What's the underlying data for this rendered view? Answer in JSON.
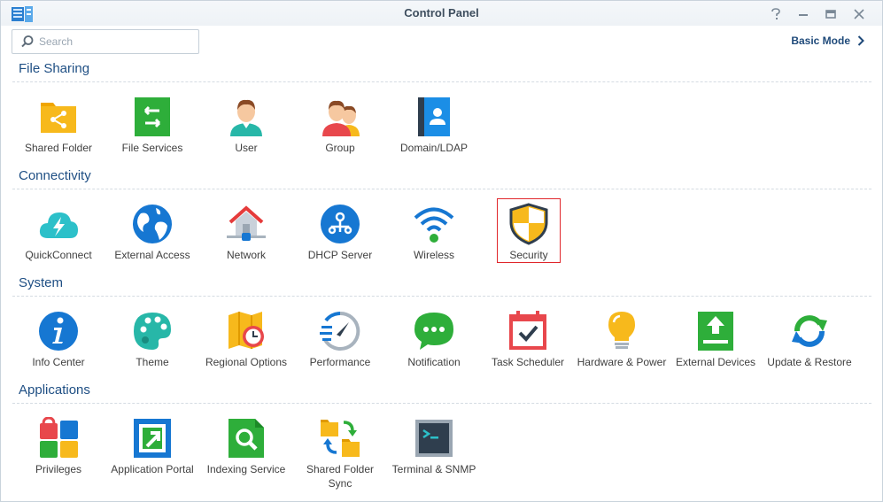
{
  "window": {
    "title": "Control Panel",
    "controls": [
      "help-icon",
      "minimize-icon",
      "maximize-icon",
      "close-icon"
    ]
  },
  "search": {
    "placeholder": "Search",
    "value": ""
  },
  "mode_toggle": {
    "label": "Basic Mode"
  },
  "colors": {
    "accent": "#1f4f84",
    "selection": "#e0262b"
  },
  "sections": [
    {
      "title": "File Sharing",
      "items": [
        {
          "label": "Shared Folder",
          "icon": "shared-folder-icon"
        },
        {
          "label": "File Services",
          "icon": "file-services-icon"
        },
        {
          "label": "User",
          "icon": "user-icon"
        },
        {
          "label": "Group",
          "icon": "group-icon"
        },
        {
          "label": "Domain/LDAP",
          "icon": "domain-ldap-icon"
        }
      ]
    },
    {
      "title": "Connectivity",
      "items": [
        {
          "label": "QuickConnect",
          "icon": "quickconnect-icon"
        },
        {
          "label": "External Access",
          "icon": "external-access-icon"
        },
        {
          "label": "Network",
          "icon": "network-icon"
        },
        {
          "label": "DHCP Server",
          "icon": "dhcp-server-icon"
        },
        {
          "label": "Wireless",
          "icon": "wireless-icon"
        },
        {
          "label": "Security",
          "icon": "security-icon",
          "selected": true
        }
      ]
    },
    {
      "title": "System",
      "items": [
        {
          "label": "Info Center",
          "icon": "info-center-icon"
        },
        {
          "label": "Theme",
          "icon": "theme-icon"
        },
        {
          "label": "Regional Options",
          "icon": "regional-options-icon"
        },
        {
          "label": "Performance",
          "icon": "performance-icon"
        },
        {
          "label": "Notification",
          "icon": "notification-icon"
        },
        {
          "label": "Task Scheduler",
          "icon": "task-scheduler-icon"
        },
        {
          "label": "Hardware & Power",
          "icon": "hardware-power-icon"
        },
        {
          "label": "External Devices",
          "icon": "external-devices-icon"
        },
        {
          "label": "Update & Restore",
          "icon": "update-restore-icon"
        }
      ]
    },
    {
      "title": "Applications",
      "items": [
        {
          "label": "Privileges",
          "icon": "privileges-icon"
        },
        {
          "label": "Application Portal",
          "icon": "application-portal-icon"
        },
        {
          "label": "Indexing Service",
          "icon": "indexing-service-icon"
        },
        {
          "label": "Shared Folder Sync",
          "icon": "shared-folder-sync-icon"
        },
        {
          "label": "Terminal & SNMP",
          "icon": "terminal-snmp-icon"
        }
      ]
    }
  ]
}
